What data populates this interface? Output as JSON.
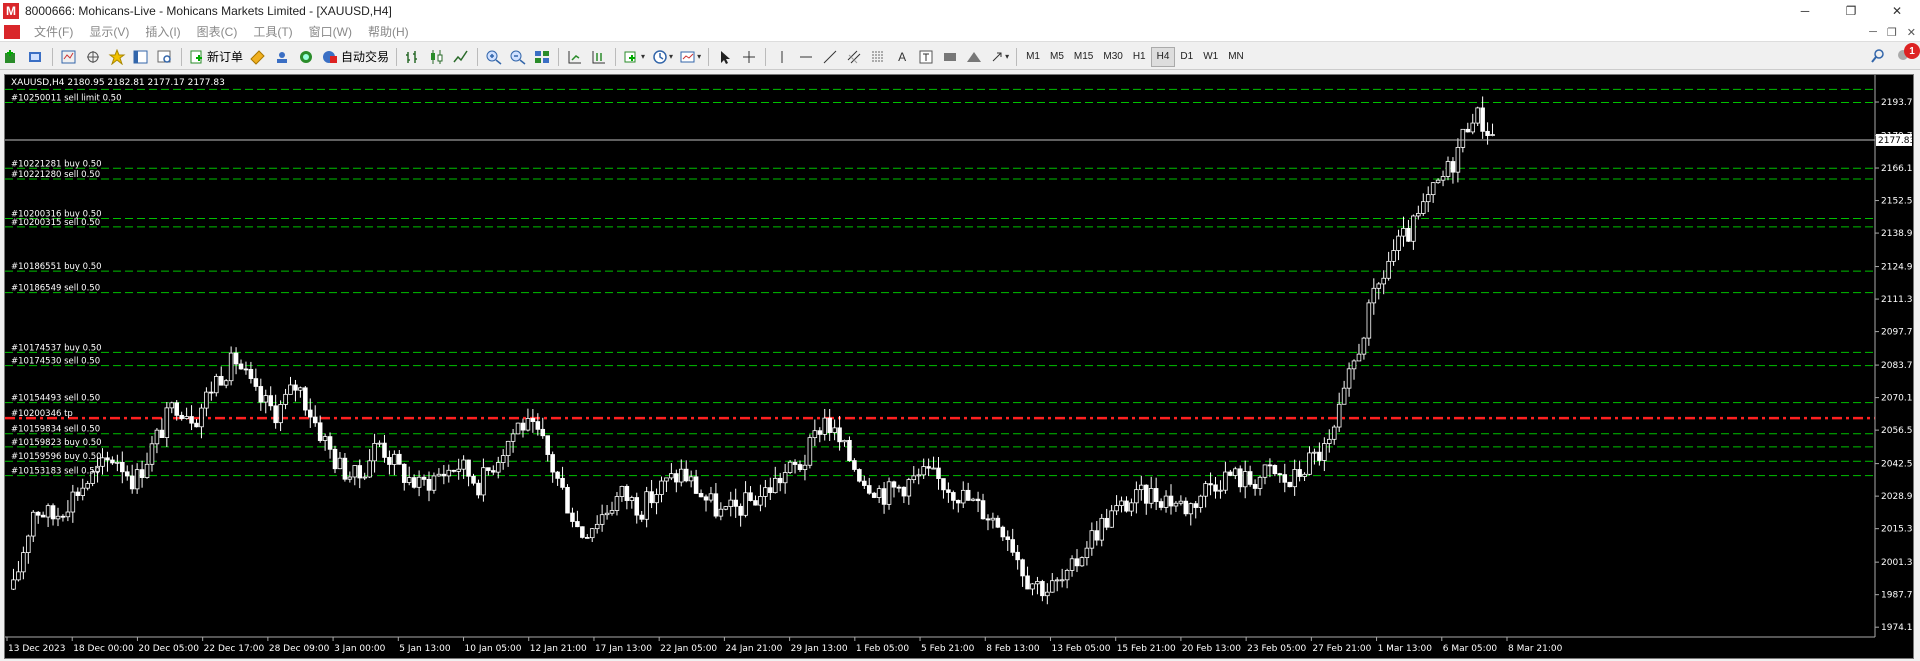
{
  "window": {
    "title": "8000666: Mohicans-Live - Mohicans Markets Limited - [XAUUSD,H4]",
    "app_icon_letter": "M",
    "minimize": "─",
    "restore": "❐",
    "close": "✕"
  },
  "menu": {
    "items": [
      "文件(F)",
      "显示(V)",
      "插入(I)",
      "图表(C)",
      "工具(T)",
      "窗口(W)",
      "帮助(H)"
    ]
  },
  "toolbar": {
    "new_order_label": "新订单",
    "auto_trading_label": "自动交易",
    "timeframes": [
      "M1",
      "M5",
      "M15",
      "M30",
      "H1",
      "H4",
      "D1",
      "W1",
      "MN"
    ],
    "active_timeframe": "H4",
    "notification_count": "1"
  },
  "chart_data": {
    "type": "candlestick",
    "symbol_header": "XAUUSD,H4 2180.95 2182.81 2177.17 2177.83",
    "current_price": 2177.83,
    "y_range": [
      1970.0,
      2205.0
    ],
    "y_ticks": [
      "1974.10",
      "1987.70",
      "2001.30",
      "2015.30",
      "2028.90",
      "2042.50",
      "2056.50",
      "2070.10",
      "2083.70",
      "2097.70",
      "2111.30",
      "2124.90",
      "2138.90",
      "2152.50",
      "2166.10",
      "2179.70",
      "2193.70"
    ],
    "x_ticks": [
      "13 Dec 2023",
      "18 Dec 00:00",
      "20 Dec 05:00",
      "22 Dec 17:00",
      "28 Dec 09:00",
      "3 Jan 00:00",
      "5 Jan 13:00",
      "10 Jan 05:00",
      "12 Jan 21:00",
      "17 Jan 13:00",
      "22 Jan 05:00",
      "24 Jan 21:00",
      "29 Jan 13:00",
      "1 Feb 05:00",
      "5 Feb 21:00",
      "8 Feb 13:00",
      "13 Feb 05:00",
      "15 Feb 21:00",
      "20 Feb 13:00",
      "23 Feb 05:00",
      "27 Feb 21:00",
      "1 Mar 13:00",
      "6 Mar 05:00",
      "8 Mar 21:00"
    ],
    "close_path": [
      1990,
      2024,
      2020,
      2030,
      2038,
      2046,
      2035,
      2052,
      2068,
      2062,
      2078,
      2086,
      2070,
      2064,
      2076,
      2058,
      2042,
      2036,
      2052,
      2040,
      2033,
      2038,
      2042,
      2034,
      2047,
      2060,
      2053,
      2033,
      2013,
      2021,
      2030,
      2024,
      2033,
      2039,
      2029,
      2021,
      2025,
      2030,
      2038,
      2043,
      2062,
      2048,
      2036,
      2030,
      2034,
      2038,
      2034,
      2028,
      2022,
      2015,
      1995,
      1990,
      1994,
      2010,
      2020,
      2026,
      2030,
      2028,
      2024,
      2034,
      2038,
      2035,
      2039,
      2034,
      2044,
      2050,
      2080,
      2108,
      2130,
      2140,
      2155,
      2168,
      2190,
      2180
    ],
    "order_lines": [
      {
        "label": "#10250011 sell limit 0.50",
        "price": 2193.5,
        "color": "#00c000",
        "dash": "8,4"
      },
      {
        "label": "",
        "price": 2199.0,
        "color": "#00c000",
        "dash": "8,4"
      },
      {
        "label": "#10221281 buy 0.50",
        "price": 2166.0,
        "color": "#00c000",
        "dash": "8,4"
      },
      {
        "label": "#10221280 sell 0.50",
        "price": 2161.5,
        "color": "#00c000",
        "dash": "8,4"
      },
      {
        "label": "#10200316 buy 0.50",
        "price": 2145.0,
        "color": "#00c000",
        "dash": "8,4"
      },
      {
        "label": "#10200315 sell 0.50",
        "price": 2141.5,
        "color": "#00c000",
        "dash": "8,4"
      },
      {
        "label": "#10186551 buy 0.50",
        "price": 2123.0,
        "color": "#00c000",
        "dash": "8,4"
      },
      {
        "label": "#10186549 sell 0.50",
        "price": 2114.0,
        "color": "#00c000",
        "dash": "8,4"
      },
      {
        "label": "#10174537 buy 0.50",
        "price": 2089.0,
        "color": "#00c000",
        "dash": "8,4"
      },
      {
        "label": "#10174530 sell 0.50",
        "price": 2083.5,
        "color": "#00c000",
        "dash": "8,4"
      },
      {
        "label": "#10154493 sell 0.50",
        "price": 2068.0,
        "color": "#00c000",
        "dash": "8,4"
      },
      {
        "label": "#10200346 tp",
        "price": 2061.5,
        "color": "#ff2020",
        "dash": "10,4,3,4"
      },
      {
        "label": "#10159834 sell 0.50",
        "price": 2055.0,
        "color": "#00c000",
        "dash": "8,4"
      },
      {
        "label": "#10159823 buy 0.50",
        "price": 2049.5,
        "color": "#00c000",
        "dash": "8,4"
      },
      {
        "label": "#10159596 buy 0.50",
        "price": 2043.5,
        "color": "#00c000",
        "dash": "8,4"
      },
      {
        "label": "#10153183 sell 0.50",
        "price": 2037.5,
        "color": "#00c000",
        "dash": "8,4"
      }
    ]
  }
}
